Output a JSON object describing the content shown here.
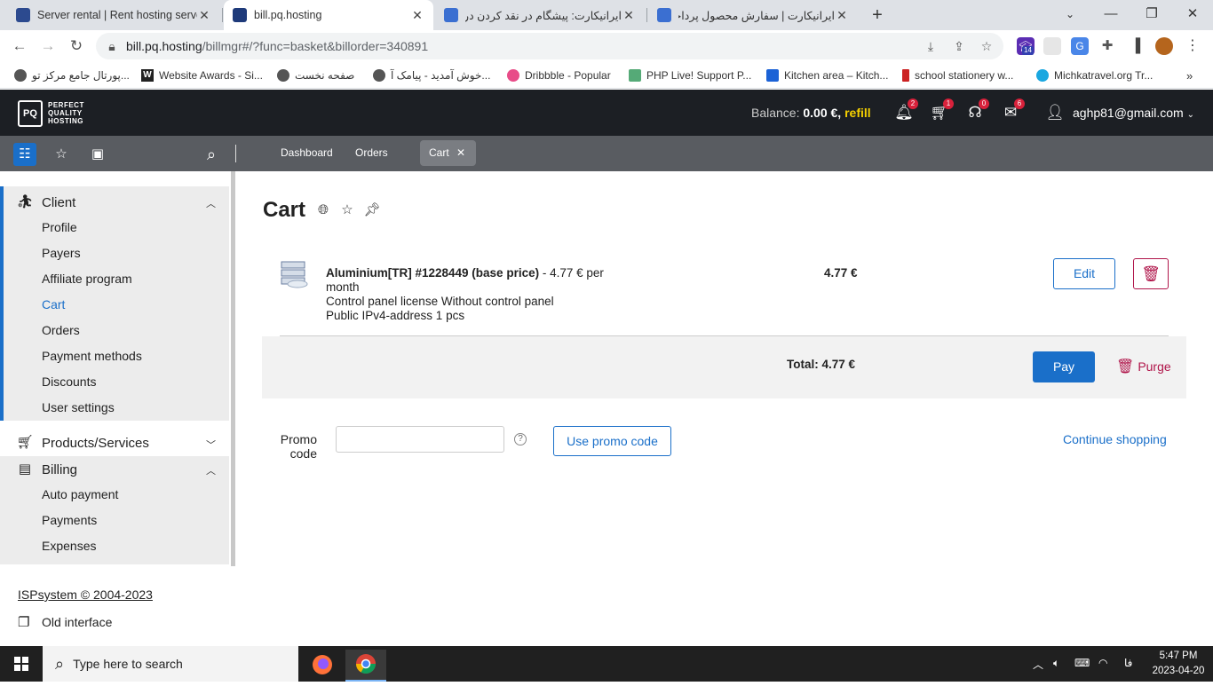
{
  "browser": {
    "tabs": [
      {
        "title": "Server rental | Rent hosting serve"
      },
      {
        "title": "bill.pq.hosting"
      },
      {
        "title": "ایرانیکارت: پیشگام در نقد کردن درآم"
      },
      {
        "title": "ایرانیکارت | سفارش محصول پرداخت"
      }
    ],
    "url_host": "bill.pq.hosting",
    "url_path": "/billmgr#/?func=basket&billorder=340891",
    "extension_badge": "14",
    "bookmarks": [
      {
        "label": "پورتال جامع مرکز تو...",
        "color": "#555"
      },
      {
        "label": "Website Awards - Si...",
        "color": "#222"
      },
      {
        "label": "صفحه نخست",
        "color": "#555"
      },
      {
        "label": "خوش آمدید - پیامک آ...",
        "color": "#555"
      },
      {
        "label": "Dribbble - Popular",
        "color": "#e84c88"
      },
      {
        "label": "PHP Live! Support P...",
        "color": "#5a7"
      },
      {
        "label": "Kitchen area – Kitch...",
        "color": "#1b62d6"
      },
      {
        "label": "school stationery w...",
        "color": "#c22"
      },
      {
        "label": "Michkatravel.org Tr...",
        "color": "#1aa7e0"
      }
    ]
  },
  "app": {
    "logo_text": "PERFECT QUALITY HOSTING",
    "balance_label": "Balance:",
    "balance_value": "0.00 €,",
    "refill_label": "refill",
    "badges": {
      "notifications": "2",
      "cart": "1",
      "support": "0",
      "messages": "6"
    },
    "user_email": "aghp81@gmail.com",
    "nav_tabs": [
      {
        "label": "Dashboard"
      },
      {
        "label": "Orders"
      },
      {
        "label": "Cart"
      }
    ]
  },
  "sidebar": {
    "client": {
      "title": "Client",
      "items": [
        {
          "label": "Profile"
        },
        {
          "label": "Payers"
        },
        {
          "label": "Affiliate program"
        },
        {
          "label": "Cart"
        },
        {
          "label": "Orders"
        },
        {
          "label": "Payment methods"
        },
        {
          "label": "Discounts"
        },
        {
          "label": "User settings"
        }
      ]
    },
    "products": {
      "title": "Products/Services"
    },
    "billing": {
      "title": "Billing",
      "items": [
        {
          "label": "Auto payment"
        },
        {
          "label": "Payments"
        },
        {
          "label": "Expenses"
        }
      ]
    },
    "copyright": "ISPsystem © 2004-2023",
    "old_interface": "Old interface"
  },
  "cart": {
    "title": "Cart",
    "order": {
      "name": "Aluminium[TR] #1228449 (base price)",
      "price_text": " - 4.77 € per month",
      "line1": "Control panel license Without control panel",
      "line2": "Public IPv4-address 1 pcs",
      "price": "4.77 €"
    },
    "edit_label": "Edit",
    "total_label": "Total: 4.77 €",
    "pay_label": "Pay",
    "purge_label": "Purge",
    "promo_label": "Promo code",
    "promo_value": "",
    "use_promo_label": "Use promo code",
    "continue_label": "Continue shopping"
  },
  "taskbar": {
    "search_placeholder": "Type here to search",
    "lang": "فا",
    "time": "5:47 PM",
    "date": "2023-04-20"
  }
}
